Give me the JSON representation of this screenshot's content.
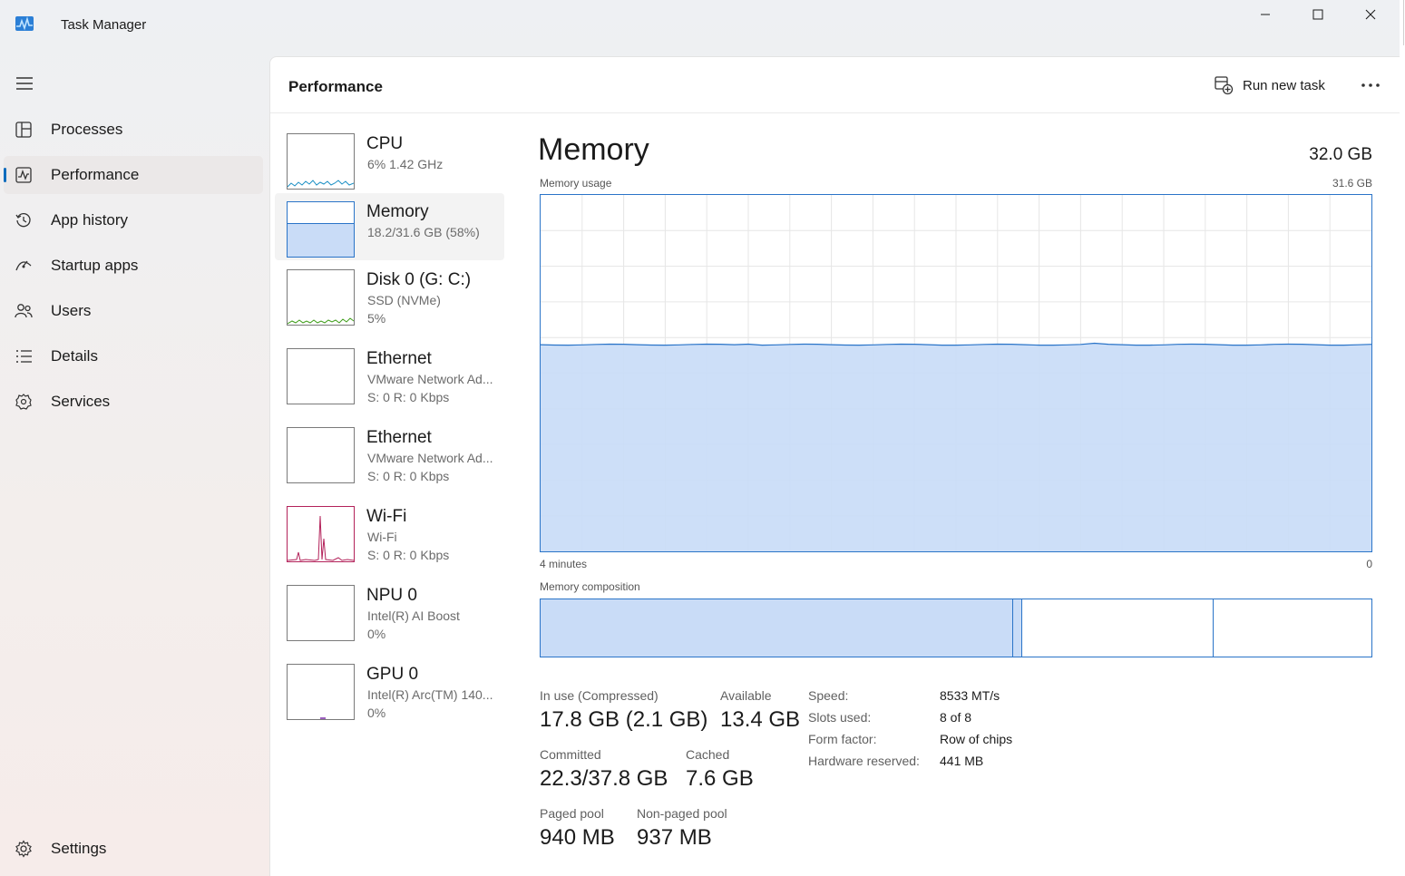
{
  "window": {
    "title": "Task Manager"
  },
  "nav": {
    "items": [
      {
        "label": "Processes",
        "icon": "processes-icon"
      },
      {
        "label": "Performance",
        "icon": "performance-icon",
        "active": true
      },
      {
        "label": "App history",
        "icon": "history-icon"
      },
      {
        "label": "Startup apps",
        "icon": "startup-icon"
      },
      {
        "label": "Users",
        "icon": "users-icon"
      },
      {
        "label": "Details",
        "icon": "details-icon"
      },
      {
        "label": "Services",
        "icon": "services-icon"
      }
    ],
    "settings": "Settings"
  },
  "header": {
    "title": "Performance",
    "run_new_task": "Run new task"
  },
  "devices": [
    {
      "name": "CPU",
      "sub1": "6%  1.42 GHz",
      "sub2": ""
    },
    {
      "name": "Memory",
      "sub1": "18.2/31.6 GB (58%)",
      "sub2": ""
    },
    {
      "name": "Disk 0 (G: C:)",
      "sub1": "SSD (NVMe)",
      "sub2": "5%"
    },
    {
      "name": "Ethernet",
      "sub1": "VMware Network Ad...",
      "sub2": "S: 0  R: 0 Kbps"
    },
    {
      "name": "Ethernet",
      "sub1": "VMware Network Ad...",
      "sub2": "S: 0  R: 0 Kbps"
    },
    {
      "name": "Wi-Fi",
      "sub1": "Wi-Fi",
      "sub2": "S: 0  R: 0 Kbps"
    },
    {
      "name": "NPU 0",
      "sub1": "Intel(R) AI Boost",
      "sub2": "0%"
    },
    {
      "name": "GPU 0",
      "sub1": "Intel(R) Arc(TM) 140...",
      "sub2": "0%"
    }
  ],
  "memory": {
    "title": "Memory",
    "total": "32.0 GB",
    "usage_label": "Memory usage",
    "usage_max": "31.6 GB",
    "time_left": "4 minutes",
    "time_right": "0",
    "composition_label": "Memory composition",
    "usage_fraction": 0.58,
    "composition": {
      "in_use_fraction": 0.568,
      "modified_fraction": 0.012,
      "standby_fraction": 0.23,
      "free_fraction": 0.19
    },
    "stats": {
      "in_use_label": "In use (Compressed)",
      "in_use_value": "17.8 GB (2.1 GB)",
      "available_label": "Available",
      "available_value": "13.4 GB",
      "committed_label": "Committed",
      "committed_value": "22.3/37.8 GB",
      "cached_label": "Cached",
      "cached_value": "7.6 GB",
      "paged_label": "Paged pool",
      "paged_value": "940 MB",
      "nonpaged_label": "Non-paged pool",
      "nonpaged_value": "937 MB"
    },
    "specs": [
      {
        "label": "Speed:",
        "value": "8533 MT/s"
      },
      {
        "label": "Slots used:",
        "value": "8 of 8"
      },
      {
        "label": "Form factor:",
        "value": "Row of chips"
      },
      {
        "label": "Hardware reserved:",
        "value": "441 MB"
      }
    ]
  },
  "colors": {
    "accent": "#0f6cbd",
    "memory_line": "#2a74c8",
    "memory_fill": "#c9dcf7",
    "cpu_line": "#1a8fc4",
    "disk_line": "#3f9e1a",
    "wifi_line": "#b3225a"
  }
}
